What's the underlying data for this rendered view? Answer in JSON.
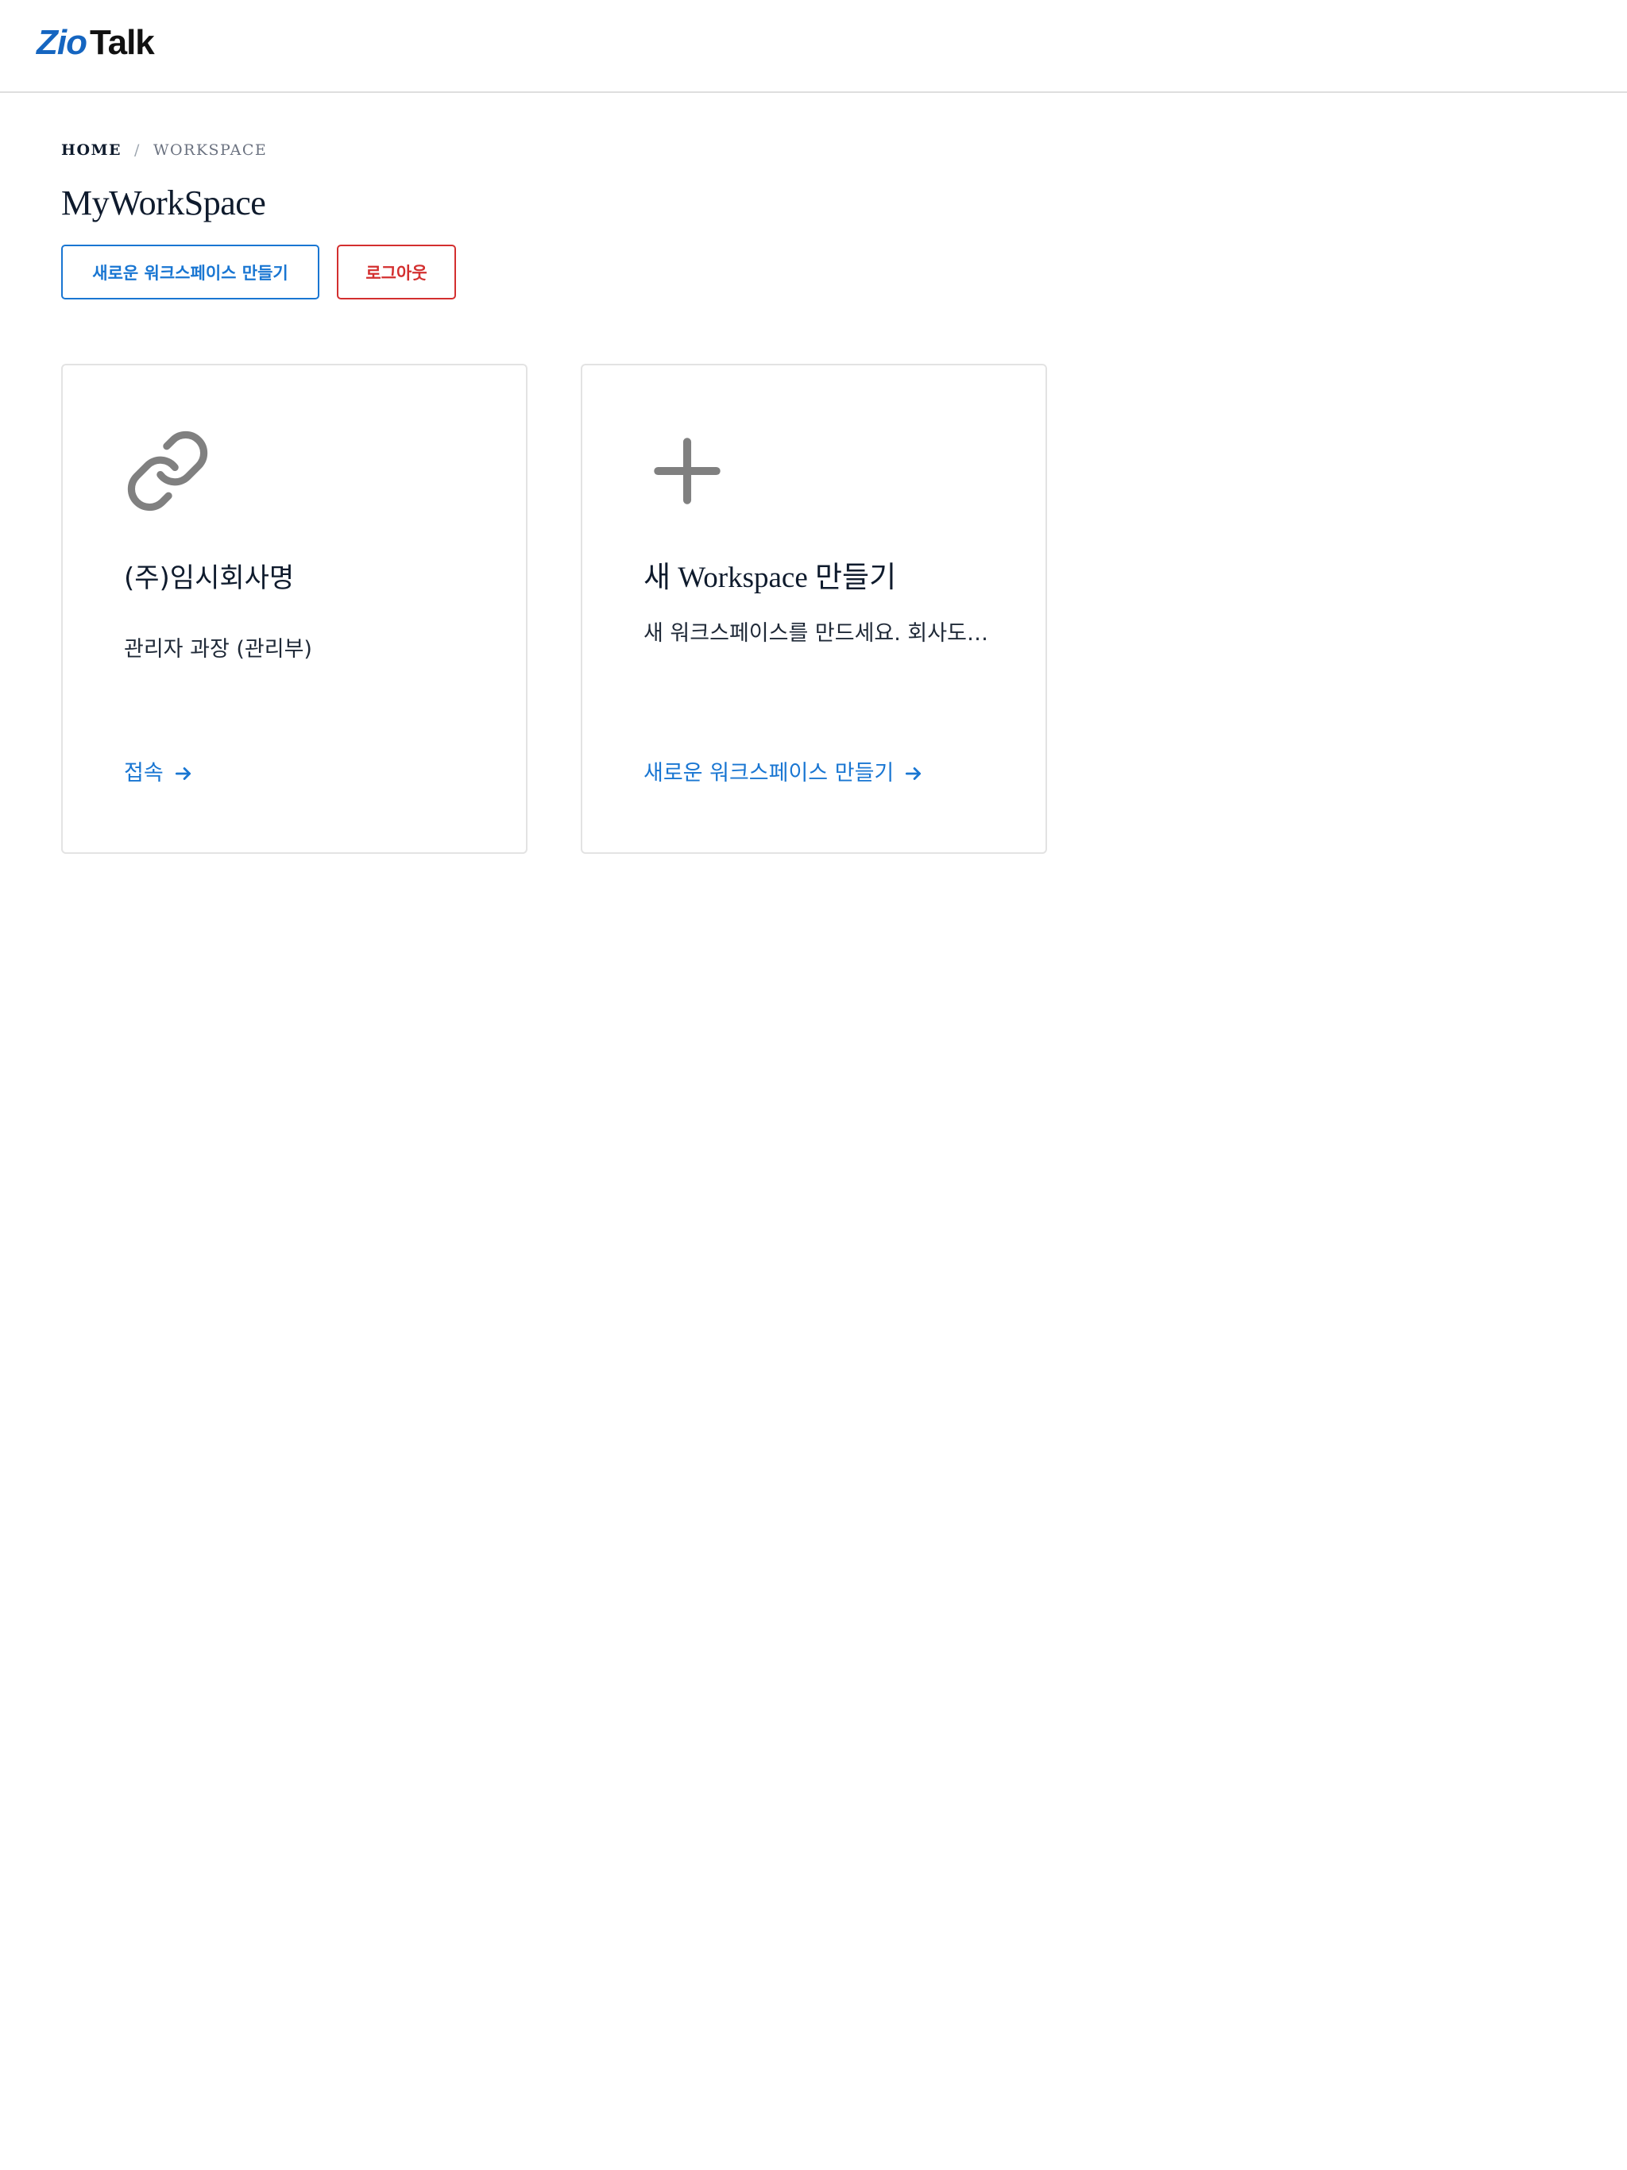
{
  "header": {
    "logo_part1": "Zio",
    "logo_part2": "Talk"
  },
  "breadcrumb": {
    "home": "HOME",
    "separator": "/",
    "current": "WORKSPACE"
  },
  "page": {
    "title": "MyWorkSpace"
  },
  "actions": {
    "create_label": "새로운 워크스페이스 만들기",
    "logout_label": "로그아웃"
  },
  "cards": [
    {
      "icon": "link-icon",
      "title": "(주)임시회사명",
      "description": "관리자 과장 (관리부)",
      "link_label": "접속"
    },
    {
      "icon": "plus-icon",
      "title": "새 Workspace 만들기",
      "description": "새 워크스페이스를 만드세요. 회사도,...",
      "link_label": "새로운 워크스페이스 만들기"
    }
  ],
  "colors": {
    "primary": "#1976d2",
    "danger": "#d32f2f",
    "brand": "#1565c0",
    "icon_gray": "#808080"
  }
}
